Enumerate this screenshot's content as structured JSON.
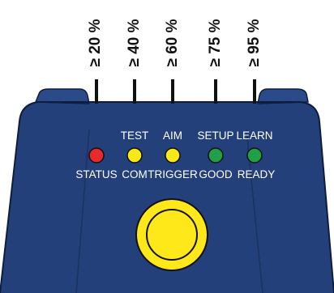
{
  "thresholds": [
    {
      "label": "≥ 20 %"
    },
    {
      "label": "≥ 40 %"
    },
    {
      "label": "≥ 60 %"
    },
    {
      "label": "≥ 75 %"
    },
    {
      "label": "≥ 95 %"
    }
  ],
  "leds": [
    {
      "top_label": "",
      "bottom_label": "STATUS",
      "color": "#e82a2a"
    },
    {
      "top_label": "TEST",
      "bottom_label": "COM",
      "color": "#f7e81a"
    },
    {
      "top_label": "AIM",
      "bottom_label": "TRIGGER",
      "color": "#f7e81a"
    },
    {
      "top_label": "SETUP",
      "bottom_label": "GOOD",
      "color": "#21a04a"
    },
    {
      "top_label": "LEARN",
      "bottom_label": "READY",
      "color": "#21a04a"
    }
  ],
  "colors": {
    "panel": "#24407a",
    "panel_dark": "#1b3160",
    "button_yellow": "#ffe81a"
  }
}
